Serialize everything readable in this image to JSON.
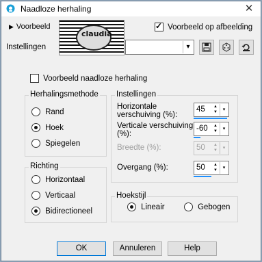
{
  "window": {
    "title": "Naadloze herhaling",
    "close_glyph": "✕"
  },
  "toolbar": {
    "preview_label": "Voorbeeld",
    "preview_on_image_label": "Voorbeeld op afbeelding",
    "preview_on_image_checked": true,
    "settings_label": "Instellingen",
    "settings_value": ""
  },
  "thumb": {
    "caption": "claudia"
  },
  "seamless_preview": {
    "label": "Voorbeeld naadloze herhaling",
    "checked": false
  },
  "method": {
    "title": "Herhalingsmethode",
    "options": [
      {
        "label": "Rand",
        "selected": false
      },
      {
        "label": "Hoek",
        "selected": true
      },
      {
        "label": "Spiegelen",
        "selected": false
      }
    ]
  },
  "direction": {
    "title": "Richting",
    "options": [
      {
        "label": "Horizontaal",
        "selected": false
      },
      {
        "label": "Verticaal",
        "selected": false
      },
      {
        "label": "Bidirectioneel",
        "selected": true
      }
    ]
  },
  "settings": {
    "title": "Instellingen",
    "horizontal": {
      "label_1": "Horizontale",
      "label_2": "verschuiving (%):",
      "value": "45",
      "fill": 0.95
    },
    "vertical": {
      "label_1": "Verticale verschuiving",
      "label_2": "(%):",
      "value": "-60",
      "fill": 0.2
    },
    "width": {
      "label": "Breedte (%):",
      "value": "50",
      "disabled": true
    },
    "transition": {
      "label": "Overgang (%):",
      "value": "50",
      "fill": 0.5
    }
  },
  "corner_style": {
    "title": "Hoekstijl",
    "options": [
      {
        "label": "Lineair",
        "selected": true
      },
      {
        "label": "Gebogen",
        "selected": false
      }
    ]
  },
  "buttons": {
    "ok": "OK",
    "cancel": "Annuleren",
    "help": "Help"
  },
  "icons": {
    "dropdown": "▾",
    "spin_up": "▲",
    "spin_down": "▼",
    "expand": "▶"
  },
  "colors": {
    "accent": "#1e90ff",
    "title_icon": "#18a0d8"
  }
}
